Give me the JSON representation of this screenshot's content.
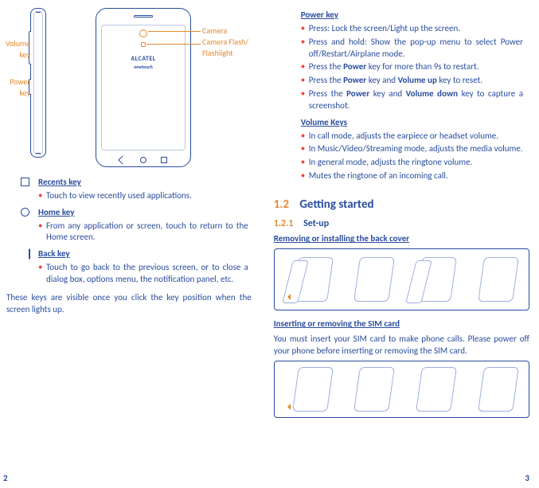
{
  "illustration": {
    "brand_top": "ALCATEL",
    "brand_sub": "onetouch",
    "labels": {
      "volume": "Volume key",
      "power": "Power key",
      "camera": "Camera",
      "flash": "Camera Flash/ Flashlight"
    }
  },
  "left": {
    "recents": {
      "title": "Recents key",
      "items": [
        "Touch to view recently used applications."
      ]
    },
    "home": {
      "title": "Home key",
      "items": [
        "From any application or screen, touch to return to the Home screen."
      ]
    },
    "back": {
      "title": "Back key",
      "items": [
        "Touch to go back to the previous screen, or to close a dialog box, options menu, the notification panel, etc."
      ]
    },
    "note": "These keys are visible once you click the key position when the screen lights up.",
    "page_num": "2"
  },
  "right": {
    "power": {
      "title": "Power key",
      "items": [
        "Press: Lock the screen/Light up the screen.",
        "Press and hold: Show the pop-up menu to select Power off/Restart/Airplane mode.",
        "Press the <b>Power</b> key for more than 9s to restart.",
        "Press the <b>Power</b> key and <b>Volume up</b> key to reset.",
        "Press the <b>Power</b> key and <b>Volume down</b> key to capture a screenshot."
      ]
    },
    "volume": {
      "title": "Volume Keys ",
      "items": [
        "In call mode,  adjusts the earpiece or headset volume.",
        "In Music/Video/Streaming mode, adjusts the media volume.",
        "In general mode, adjusts the ringtone volume.",
        "Mutes the ringtone of an incoming call."
      ]
    },
    "section": {
      "num": "1.2",
      "title": "Getting started"
    },
    "subsection": {
      "num": "1.2.1",
      "title": "Set-up"
    },
    "head_cover": "Removing or installing the back cover",
    "head_sim": "Inserting or removing the SIM card",
    "sim_para": "You must insert your SIM card to make phone calls. Please power off your phone before inserting or removing the SIM card.",
    "page_num": "3"
  }
}
